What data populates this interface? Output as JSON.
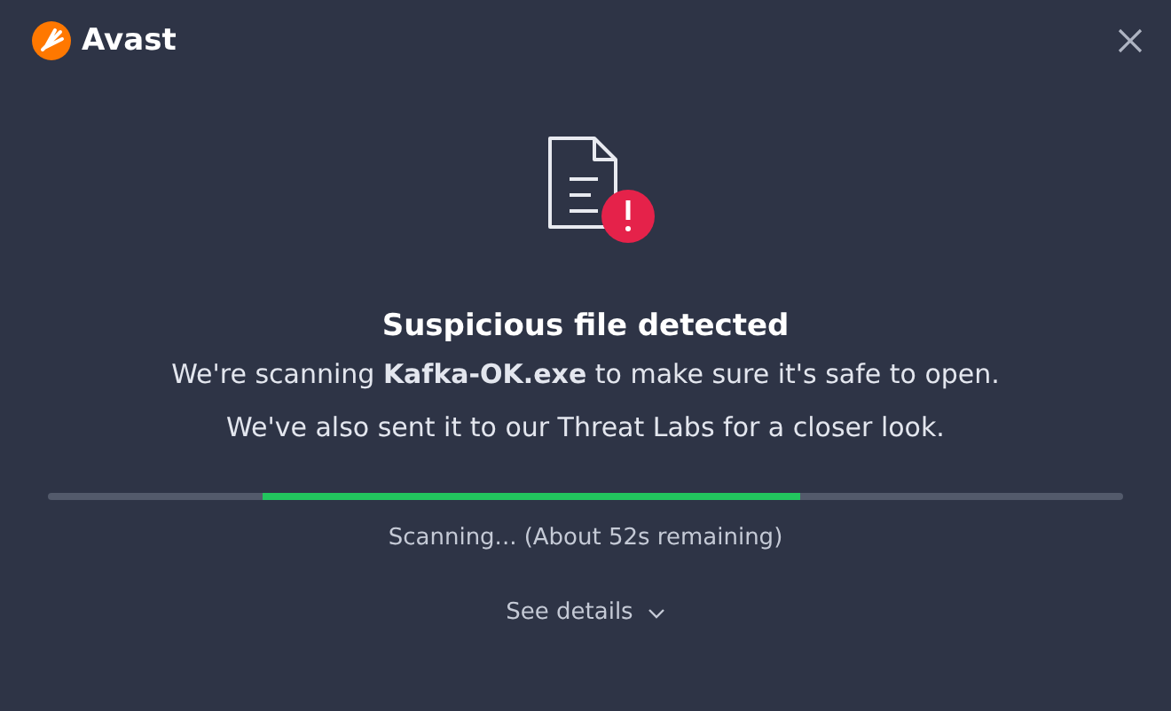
{
  "app": {
    "name": "Avast"
  },
  "alert": {
    "title": "Suspicious file detected",
    "messages": [
      "We're scanning **Kafka-OK.exe** to make sure it's safe to open.",
      "We've also sent it to our Threat Labs for a closer look."
    ]
  },
  "progress": {
    "status": "Scanning... (About 52s remaining)"
  },
  "details_link": {
    "label": "See details",
    "expanded": false
  }
}
